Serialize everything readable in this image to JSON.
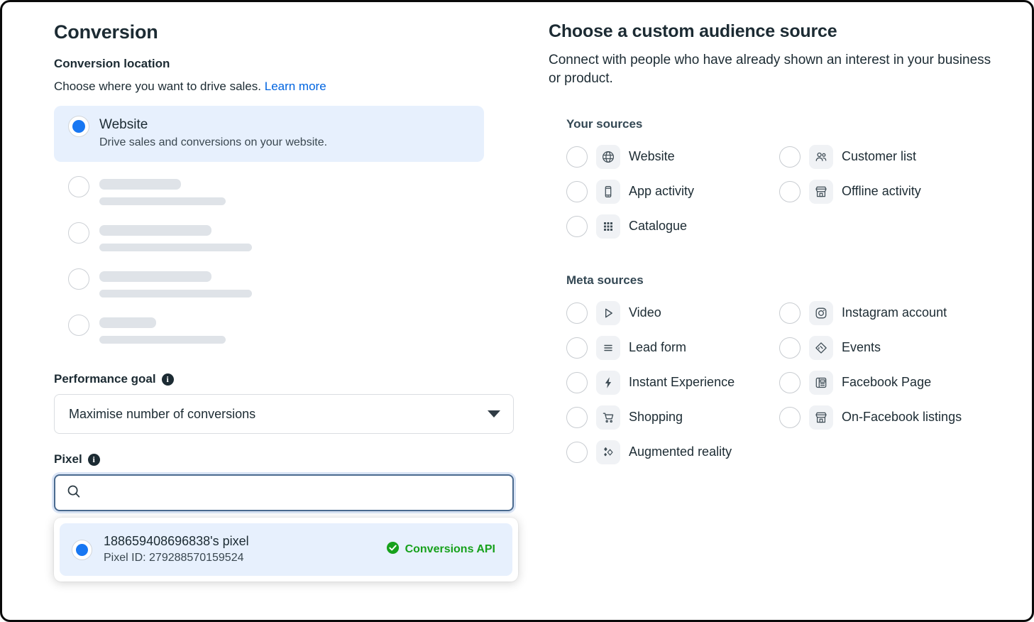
{
  "conversion": {
    "title": "Conversion",
    "location_label": "Conversion location",
    "location_desc": "Choose where you want to drive sales.",
    "learn_more": "Learn more",
    "selected_option": {
      "title": "Website",
      "desc": "Drive sales and conversions on your website."
    },
    "skeleton_rows": [
      {
        "w1": 115,
        "w2": 178
      },
      {
        "w1": 158,
        "w2": 215
      },
      {
        "w1": 158,
        "w2": 215
      },
      {
        "w1": 80,
        "w2": 178
      }
    ],
    "performance_goal": {
      "label": "Performance goal",
      "info": "i",
      "value": "Maximise number of conversions"
    },
    "pixel": {
      "label": "Pixel",
      "info": "i",
      "search_placeholder": "",
      "search_value": "",
      "option": {
        "title": "188659408696838's pixel",
        "subtitle": "Pixel ID: 279288570159524",
        "badge": "Conversions API"
      }
    }
  },
  "audience": {
    "title": "Choose a custom audience source",
    "desc": "Connect with people who have already shown an interest in your business or product.",
    "your_sources_title": "Your sources",
    "your_sources": [
      {
        "label": "Website",
        "icon": "globe-icon"
      },
      {
        "label": "Customer list",
        "icon": "people-icon"
      },
      {
        "label": "App activity",
        "icon": "mobile-icon"
      },
      {
        "label": "Offline activity",
        "icon": "storefront-icon"
      },
      {
        "label": "Catalogue",
        "icon": "grid-icon"
      }
    ],
    "meta_sources_title": "Meta sources",
    "meta_sources": [
      {
        "label": "Video",
        "icon": "play-icon"
      },
      {
        "label": "Instagram account",
        "icon": "instagram-icon"
      },
      {
        "label": "Lead form",
        "icon": "list-icon"
      },
      {
        "label": "Events",
        "icon": "ticket-icon"
      },
      {
        "label": "Instant Experience",
        "icon": "bolt-icon"
      },
      {
        "label": "Facebook Page",
        "icon": "page-icon"
      },
      {
        "label": "Shopping",
        "icon": "cart-icon"
      },
      {
        "label": "On-Facebook listings",
        "icon": "storefront-icon"
      },
      {
        "label": "Augmented reality",
        "icon": "sparkles-icon"
      }
    ]
  },
  "colors": {
    "accent_blue": "#1877f2",
    "link_blue": "#0064e0",
    "selected_bg": "#e7f0fd",
    "success_green": "#17a11c",
    "text": "#1c2b33"
  }
}
